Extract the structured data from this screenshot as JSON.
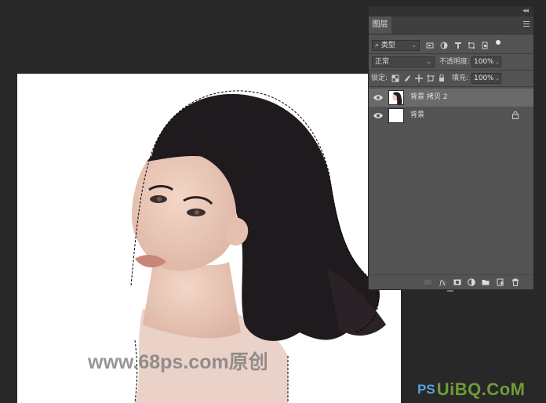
{
  "document": {
    "watermark": "www.68ps.com原创",
    "logo_ps": "PS",
    "logo_site": "UiBQ.CoM"
  },
  "layers_panel": {
    "tab_label": "图层",
    "filter_kind": "类型",
    "blend_mode": "正常",
    "opacity_label": "不透明度:",
    "opacity_value": "100%",
    "lock_label": "锁定:",
    "fill_label": "填充:",
    "fill_value": "100%",
    "layers": [
      {
        "name": "背景 拷贝 2",
        "visible": true,
        "selected": true,
        "locked": false,
        "thumb": "portrait"
      },
      {
        "name": "背景",
        "visible": true,
        "selected": false,
        "locked": true,
        "thumb": "white"
      }
    ],
    "footer_icons": [
      "link-icon",
      "fx-icon",
      "mask-icon",
      "adjustment-icon",
      "group-folder-icon",
      "new-layer-icon",
      "trash-icon"
    ]
  },
  "colors": {
    "workspace": "#282828",
    "panel": "#535353",
    "selected_layer": "#6a6a6a"
  }
}
